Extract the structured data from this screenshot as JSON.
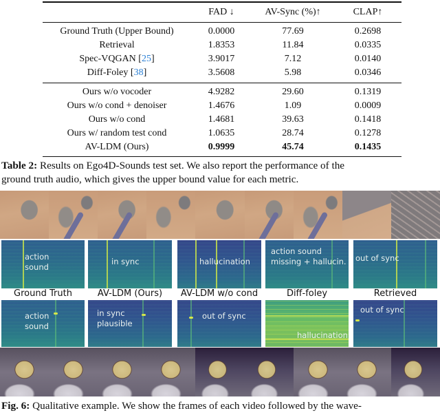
{
  "table": {
    "headers": [
      "",
      "FAD ↓",
      "AV-Sync (%)↑",
      "CLAP↑"
    ],
    "group1": [
      {
        "method": "Ground Truth (Upper Bound)",
        "cite": "",
        "fad": "0.0000",
        "av_sync": "77.69",
        "clap": "0.2698"
      },
      {
        "method": "Retrieval",
        "cite": "",
        "fad": "1.8353",
        "av_sync": "11.84",
        "clap": "0.0335"
      },
      {
        "method": "Spec-VQGAN",
        "cite": "25",
        "fad": "3.9017",
        "av_sync": "7.12",
        "clap": "0.0140"
      },
      {
        "method": "Diff-Foley",
        "cite": "38",
        "fad": "3.5608",
        "av_sync": "5.98",
        "clap": "0.0346"
      }
    ],
    "group2": [
      {
        "method": "Ours w/o vocoder",
        "fad": "4.9282",
        "av_sync": "29.60",
        "clap": "0.1319"
      },
      {
        "method": "Ours w/o cond + denoiser",
        "fad": "1.4676",
        "av_sync": "1.09",
        "clap": "0.0009"
      },
      {
        "method": "Ours w/o cond",
        "fad": "1.4681",
        "av_sync": "39.63",
        "clap": "0.1418"
      },
      {
        "method": "Ours w/ random test cond",
        "fad": "1.0635",
        "av_sync": "28.74",
        "clap": "0.1278"
      },
      {
        "method": "AV-LDM (Ours)",
        "fad": "0.9999",
        "av_sync": "45.74",
        "clap": "0.1435",
        "bold_values": true
      }
    ]
  },
  "table_caption": {
    "label": "Table 2:",
    "line1": " Results on Ego4D-Sounds test set. We also report the performance of the",
    "line2": "ground truth audio, which gives the upper bound value for each metric."
  },
  "figure": {
    "model_labels": [
      "Ground Truth",
      "AV-LDM (Ours)",
      "AV-LDM w/o cond",
      "Diff-foley",
      "Retrieved"
    ],
    "example1_annotations": [
      "action\nsound",
      "in sync",
      "hallucination",
      "action sound\nmissing + hallucin.",
      "out of sync"
    ],
    "example2_annotations": [
      "action\nsound",
      "in sync\nplausible",
      "out of sync",
      "hallucination",
      "out of sync"
    ]
  },
  "figure_caption": {
    "label": "Fig. 6:",
    "text": " Qualitative example. We show the frames of each video followed by the wave-"
  }
}
